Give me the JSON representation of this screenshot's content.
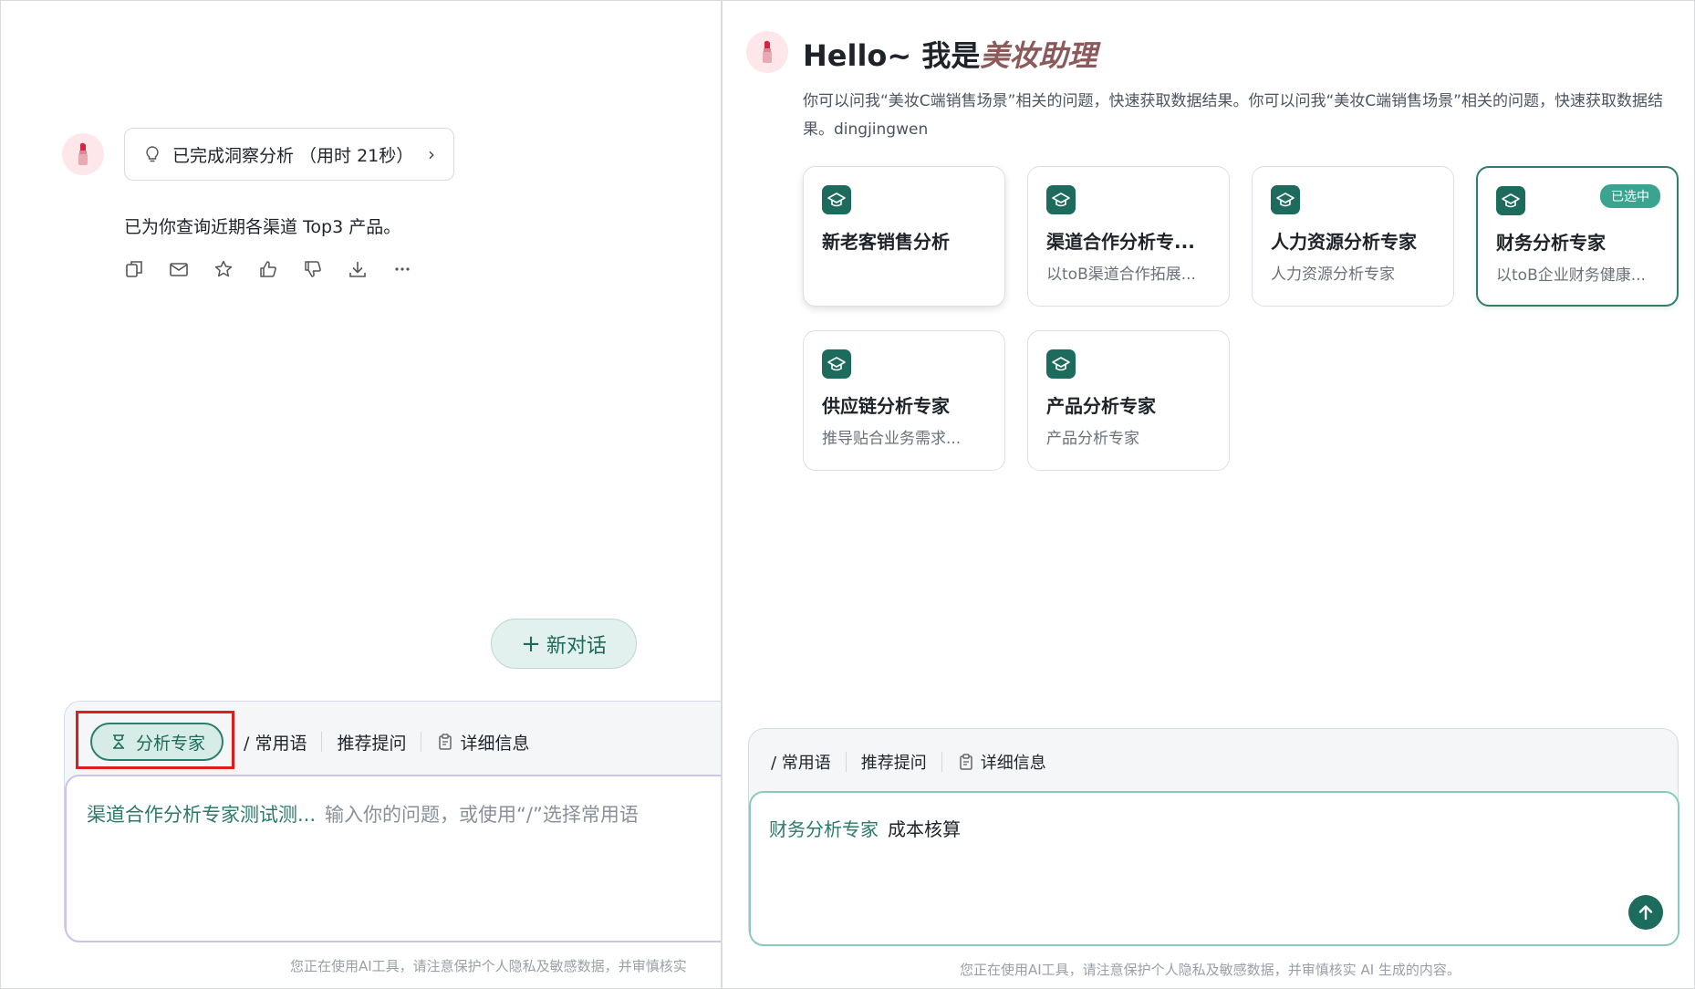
{
  "colors": {
    "accent": "#1d6b5c",
    "accent_light": "#d7ece7",
    "highlight": "#e01c1c",
    "brand_text": "#8c5a5a"
  },
  "left": {
    "avatar_icon": "lipstick-icon",
    "insight_label": "已完成洞察分析 （用时 21秒）",
    "answer": "已为你查询近期各渠道 Top3 产品。",
    "actions": [
      "copy-icon",
      "mail-icon",
      "star-icon",
      "thumbs-up-icon",
      "thumbs-down-icon",
      "download-icon",
      "more-icon"
    ],
    "new_chat_label": "新对话",
    "toolbar": {
      "expert_label": "分析专家",
      "phrases_label": "/ 常用语",
      "recommend_label": "推荐提问",
      "details_label": "详细信息"
    },
    "input": {
      "expert_tag": "渠道合作分析专家测试测...",
      "placeholder": "输入你的问题，或使用“/”选择常用语"
    },
    "disclaimer": "您正在使用AI工具，请注意保护个人隐私及敏感数据，并审慎核实"
  },
  "right": {
    "greeting": "Hello~ 我是",
    "brand": "美妆助理",
    "intro": "你可以问我“美妆C端销售场景”相关的问题，快速获取数据结果。你可以问我“美妆C端销售场景”相关的问题，快速获取数据结果。dingjingwen",
    "cards": [
      {
        "title": "新老客销售分析",
        "desc": "",
        "selected": false
      },
      {
        "title": "渠道合作分析专...",
        "desc": "以toB渠道合作拓展...",
        "selected": false
      },
      {
        "title": "人力资源分析专家",
        "desc": "人力资源分析专家",
        "selected": false
      },
      {
        "title": "财务分析专家",
        "desc": "以toB企业财务健康...",
        "selected": true,
        "badge": "已选中"
      },
      {
        "title": "供应链分析专家",
        "desc": "推导贴合业务需求...",
        "selected": false
      },
      {
        "title": "产品分析专家",
        "desc": "产品分析专家",
        "selected": false
      }
    ],
    "toolbar": {
      "phrases_label": "/ 常用语",
      "recommend_label": "推荐提问",
      "details_label": "详细信息"
    },
    "input": {
      "expert_tag": "财务分析专家",
      "value": "成本核算"
    },
    "send_icon": "arrow-up-icon",
    "disclaimer": "您正在使用AI工具，请注意保护个人隐私及敏感数据，并审慎核实 AI 生成的内容。"
  }
}
